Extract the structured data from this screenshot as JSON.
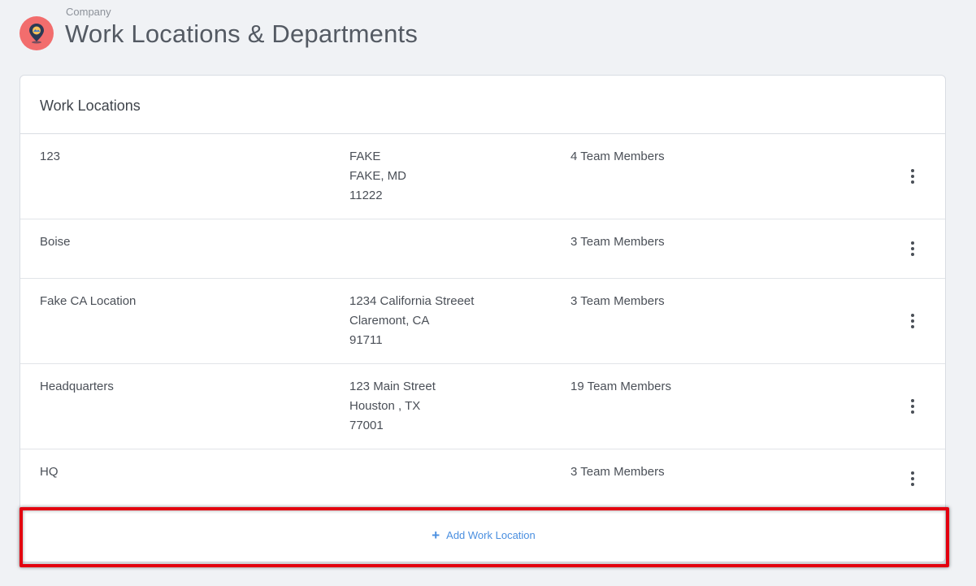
{
  "header": {
    "breadcrumb": "Company",
    "title": "Work Locations & Departments",
    "icon": "location-pin-icon"
  },
  "card": {
    "title": "Work Locations",
    "rows": [
      {
        "name": "123",
        "address": [
          "FAKE",
          "FAKE, MD",
          "11222"
        ],
        "members": "4 Team Members"
      },
      {
        "name": "Boise",
        "address": [],
        "members": "3 Team Members"
      },
      {
        "name": "Fake CA Location",
        "address": [
          "1234 California Streeet",
          "Claremont, CA",
          "91711"
        ],
        "members": "3 Team Members"
      },
      {
        "name": "Headquarters",
        "address": [
          "123 Main Street",
          "Houston , TX",
          "77001"
        ],
        "members": "19 Team Members"
      },
      {
        "name": "HQ",
        "address": [],
        "members": "3 Team Members"
      }
    ],
    "add_label": "Add Work Location"
  },
  "colors": {
    "accent": "#4a8fe0",
    "icon_bg": "#f26d6d",
    "highlight": "#e3000f"
  }
}
